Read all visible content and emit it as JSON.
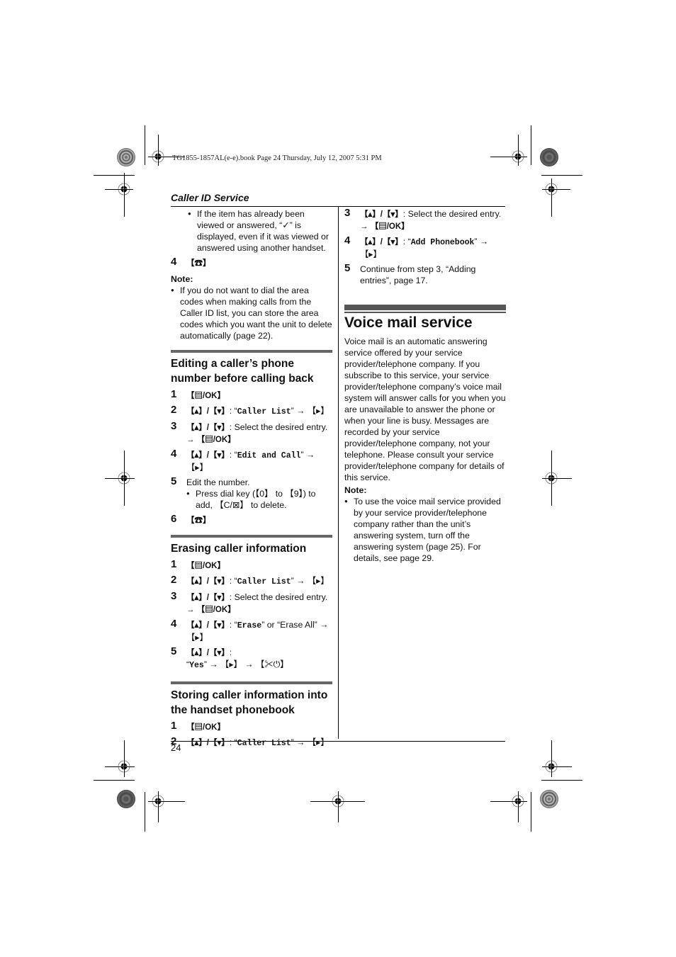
{
  "slug": "TG1855-1857AL(e-e).book  Page 24  Thursday, July 12, 2007  5:31 PM",
  "running_head": "Caller ID Service",
  "page_number": "24",
  "left_column": {
    "intro_bullet": "If the item has already been viewed or answered, “✓” is displayed, even if it was viewed or answered using another handset.",
    "step4_num": "4",
    "step4_key": "【☎】",
    "note_label": "Note:",
    "note_bullet": "If you do not want to dial the area codes when making calls from the Caller ID list, you can store the area codes which you want the unit to delete automatically (page 22).",
    "section_edit": {
      "title": "Editing a caller’s phone number before calling back",
      "steps": [
        {
          "num": "1",
          "key": "【▤/OK】",
          "text": "",
          "mono": "",
          "tail": ""
        },
        {
          "num": "2",
          "key": "【▴】/【▾】",
          "text": ": “",
          "mono": "Caller List",
          "tail": "” → 【▸】"
        },
        {
          "num": "3",
          "key": "【▴】/【▾】",
          "text": ": Select the desired entry.",
          "mono": "",
          "tail": "→ 【▤/OK】"
        },
        {
          "num": "4",
          "key": "【▴】/【▾】",
          "text": ": “",
          "mono": "Edit and Call",
          "tail": "” → 【▸】"
        },
        {
          "num": "5",
          "key": "",
          "text": "Edit the number.",
          "mono": "",
          "tail": ""
        },
        {
          "num": "6",
          "key": "【☎】",
          "text": "",
          "mono": "",
          "tail": ""
        }
      ],
      "step5_bullet": "Press dial key (【0】 to 【9】) to add, 【C/⊠】 to delete."
    },
    "section_erase": {
      "title": "Erasing caller information",
      "steps": [
        {
          "num": "1",
          "key": "【▤/OK】",
          "text": "",
          "mono": "",
          "tail": ""
        },
        {
          "num": "2",
          "key": "【▴】/【▾】",
          "text": ": “",
          "mono": "Caller List",
          "tail": "” → 【▸】"
        },
        {
          "num": "3",
          "key": "【▴】/【▾】",
          "text": ": Select the desired entry.",
          "mono": "",
          "tail": "→ 【▤/OK】"
        },
        {
          "num": "4",
          "key": "【▴】/【▾】",
          "text": ": “",
          "mono": "Erase",
          "tail": "” or “Erase All” → 【▸】"
        },
        {
          "num": "5",
          "key": "【▴】/【▾】",
          "text": ": “",
          "mono": "Yes",
          "tail": "” → 【▸】 → 【✂⏻】"
        }
      ]
    },
    "section_store": {
      "title": "Storing caller information into the handset phonebook",
      "steps": [
        {
          "num": "1",
          "key": "【▤/OK】",
          "text": "",
          "mono": "",
          "tail": ""
        },
        {
          "num": "2",
          "key": "【▴】/【▾】",
          "text": ": “",
          "mono": "Caller List",
          "tail": "” → 【▸】"
        }
      ]
    }
  },
  "right_column": {
    "store_steps": [
      {
        "num": "3",
        "key": "【▴】/【▾】",
        "text": ": Select the desired entry.",
        "mono": "",
        "tail": "→ 【▤/OK】"
      },
      {
        "num": "4",
        "key": "【▴】/【▾】",
        "text": ": “",
        "mono": "Add Phonebook",
        "tail": "” → 【▸】"
      },
      {
        "num": "5",
        "key": "",
        "text": "Continue from step 3, “Adding entries”, page 17.",
        "mono": "",
        "tail": ""
      }
    ],
    "voice_mail": {
      "title": "Voice mail service",
      "body": "Voice mail is an automatic answering service offered by your service provider/telephone company. If you subscribe to this service, your service provider/telephone company’s voice mail system will answer calls for you when you are unavailable to answer the phone or when your line is busy. Messages are recorded by your service provider/telephone company, not your telephone. Please consult your service provider/telephone company for details of this service.",
      "note_label": "Note:",
      "note_bullet": "To use the voice mail service provided by your service provider/telephone company rather than the unit’s answering system, turn off the answering system (page 25). For details, see page 29."
    }
  }
}
